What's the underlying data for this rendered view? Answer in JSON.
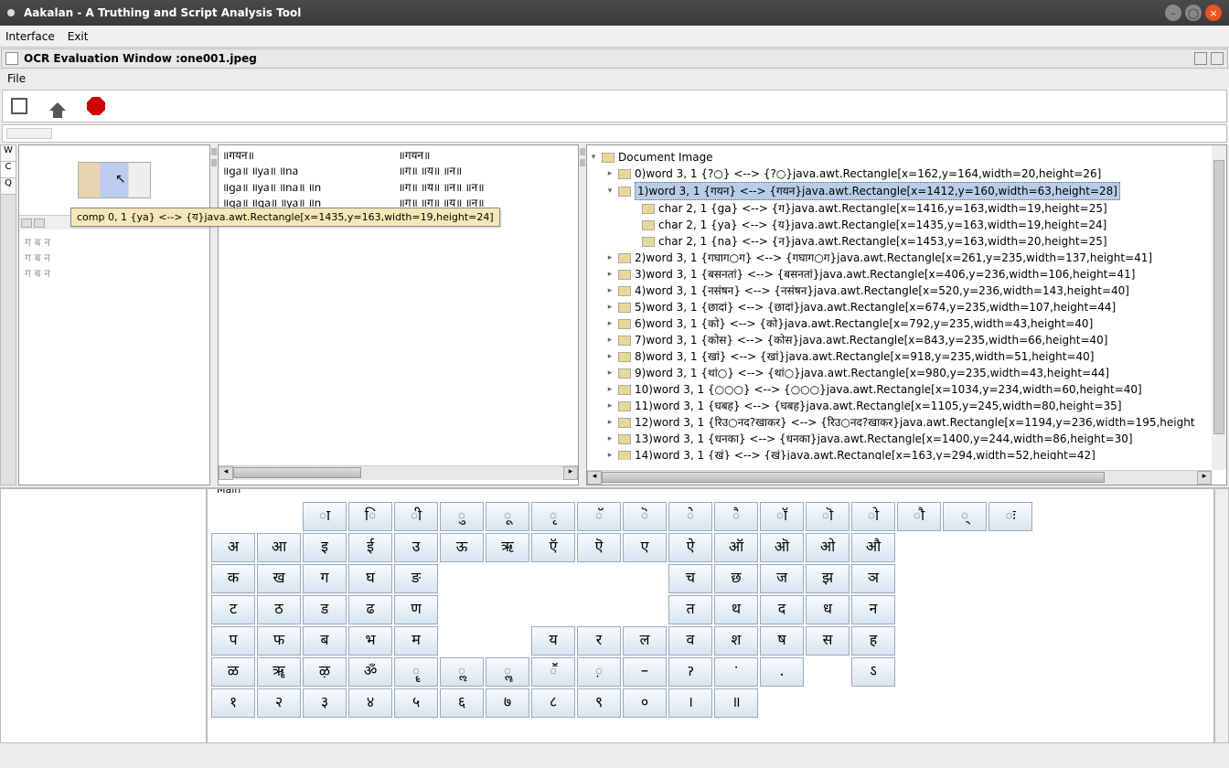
{
  "titlebar": {
    "title": "Aakalan - A Truthing and Script Analysis Tool"
  },
  "menubar": {
    "interface": "Interface",
    "exit": "Exit"
  },
  "inner_window": {
    "title": "OCR Evaluation Window :one001.jpeg"
  },
  "filemenu": {
    "file": "File"
  },
  "side_tabs": {
    "w": "W",
    "c": "C",
    "q": "Q"
  },
  "preview_lines": [
    "ग ब न",
    "ग  ब  न",
    "ग    ब    न"
  ],
  "tooltip": "comp 0, 1 {ya} <--> {य}java.awt.Rectangle[x=1435,y=163,width=19,height=24]",
  "mid_left_lines": [
    "॥गयन॥",
    "॥ga॥       ॥ya॥   ॥na",
    "॥ga॥ ॥ya॥ ॥na॥ ॥n",
    "॥ga॥  ॥ga॥  ॥ya॥  ॥n",
    "----"
  ],
  "mid_right_lines": [
    "॥गयन॥",
    "॥ग॥        ॥य॥   ॥न॥",
    "॥ग॥ ॥य॥ ॥न॥ ॥न॥",
    "॥ग॥  ॥ग॥  ॥य॥  ॥न॥",
    "----"
  ],
  "tree": {
    "root": "Document Image",
    "nodes": [
      {
        "level": 1,
        "text": "0)word 3, 1 {?○} <--> {?○}java.awt.Rectangle[x=162,y=164,width=20,height=26]"
      },
      {
        "level": 1,
        "text": "1)word 3, 1 {गयन} <--> {गयन}java.awt.Rectangle[x=1412,y=160,width=63,height=28]",
        "selected": true,
        "expanded": true
      },
      {
        "level": 2,
        "text": "char 2, 1 {ga} <--> {ग}java.awt.Rectangle[x=1416,y=163,width=19,height=25]"
      },
      {
        "level": 2,
        "text": "char 2, 1 {ya} <--> {य}java.awt.Rectangle[x=1435,y=163,width=19,height=24]"
      },
      {
        "level": 2,
        "text": "char 2, 1 {na} <--> {न}java.awt.Rectangle[x=1453,y=163,width=20,height=25]"
      },
      {
        "level": 1,
        "text": "2)word 3, 1 {गघाग○ग} <--> {गघाग○ग}java.awt.Rectangle[x=261,y=235,width=137,height=41]"
      },
      {
        "level": 1,
        "text": "3)word 3, 1 {बसनतां} <--> {बसनतां}java.awt.Rectangle[x=406,y=236,width=106,height=41]"
      },
      {
        "level": 1,
        "text": "4)word 3, 1 {नसंषन} <--> {नसंषन}java.awt.Rectangle[x=520,y=236,width=143,height=40]"
      },
      {
        "level": 1,
        "text": "5)word 3, 1 {छादां} <--> {छादां}java.awt.Rectangle[x=674,y=235,width=107,height=44]"
      },
      {
        "level": 1,
        "text": "6)word 3, 1 {को} <--> {को}java.awt.Rectangle[x=792,y=235,width=43,height=40]"
      },
      {
        "level": 1,
        "text": "7)word 3, 1 {कोस} <--> {कोस}java.awt.Rectangle[x=843,y=235,width=66,height=40]"
      },
      {
        "level": 1,
        "text": "8)word 3, 1 {खां} <--> {खां}java.awt.Rectangle[x=918,y=235,width=51,height=40]"
      },
      {
        "level": 1,
        "text": "9)word 3, 1 {थां○} <--> {थां○}java.awt.Rectangle[x=980,y=235,width=43,height=44]"
      },
      {
        "level": 1,
        "text": "10)word 3, 1 {○○○} <--> {○○○}java.awt.Rectangle[x=1034,y=234,width=60,height=40]"
      },
      {
        "level": 1,
        "text": "11)word 3, 1 {घबह} <--> {घबह}java.awt.Rectangle[x=1105,y=245,width=80,height=35]"
      },
      {
        "level": 1,
        "text": "12)word 3, 1 {रिउ○नद?खाकर} <--> {रिउ○नद?खाकर}java.awt.Rectangle[x=1194,y=236,width=195,height"
      },
      {
        "level": 1,
        "text": "13)word 3, 1 {धनका} <--> {धनका}java.awt.Rectangle[x=1400,y=244,width=86,height=30]"
      },
      {
        "level": 1,
        "text": "14)word 3, 1 {खं} <--> {खं}java.awt.Rectangle[x=163,y=294,width=52,height=42]"
      }
    ]
  },
  "keyboard": {
    "title": "Main",
    "rows": [
      [
        "",
        "ा",
        "ि",
        "ी",
        "ु",
        "ू",
        "ृ",
        "ॅ",
        "ॆ",
        "े",
        "ै",
        "ॉ",
        "ॊ",
        "ो",
        "ौ",
        "्",
        "ः"
      ],
      [
        "अ",
        "आ",
        "इ",
        "ई",
        "उ",
        "ऊ",
        "ऋ",
        "ऍ",
        "ऎ",
        "ए",
        "ऐ",
        "ऑ",
        "ऒ",
        "ओ",
        "औ"
      ],
      [
        "क",
        "ख",
        "ग",
        "घ",
        "ङ",
        "",
        "",
        "",
        "",
        "",
        "च",
        "छ",
        "ज",
        "झ",
        "ञ"
      ],
      [
        "ट",
        "ठ",
        "ड",
        "ढ",
        "ण",
        "",
        "",
        "",
        "",
        "",
        "त",
        "थ",
        "द",
        "ध",
        "न"
      ],
      [
        "प",
        "फ",
        "ब",
        "भ",
        "म",
        "",
        "",
        "य",
        "र",
        "ल",
        "व",
        "श",
        "ष",
        "स",
        "ह"
      ],
      [
        "ळ",
        "ॠ",
        "ऴ",
        "ॐ",
        "ॄ",
        "ॢ",
        "ॣ",
        "ॕ",
        "़",
        "–",
        "ॽ",
        "ॱ",
        ".",
        "",
        "ऽ"
      ],
      [
        "१",
        "२",
        "३",
        "४",
        "५",
        "६",
        "७",
        "८",
        "९",
        "०",
        "।",
        "॥"
      ]
    ]
  }
}
